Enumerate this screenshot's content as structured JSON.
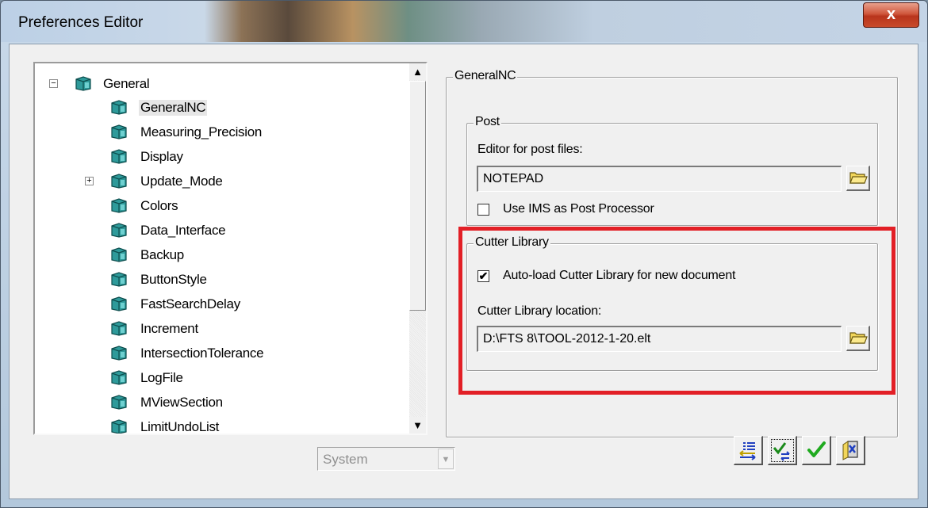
{
  "window": {
    "title": "Preferences Editor",
    "close_label": "x"
  },
  "tree": {
    "root": {
      "label": "General",
      "expander": "−"
    },
    "items": [
      {
        "label": "GeneralNC",
        "selected": true
      },
      {
        "label": "Measuring_Precision"
      },
      {
        "label": "Display"
      },
      {
        "label": "Update_Mode",
        "expander": "+"
      },
      {
        "label": "Colors"
      },
      {
        "label": "Data_Interface"
      },
      {
        "label": "Backup"
      },
      {
        "label": "ButtonStyle"
      },
      {
        "label": "FastSearchDelay"
      },
      {
        "label": "Increment"
      },
      {
        "label": "IntersectionTolerance"
      },
      {
        "label": "LogFile"
      },
      {
        "label": "MViewSection"
      },
      {
        "label": "LimitUndoList"
      }
    ],
    "scroll_up": "▲",
    "scroll_down": "▼"
  },
  "panel": {
    "title": "GeneralNC",
    "post": {
      "title": "Post",
      "editor_label": "Editor for post files:",
      "editor_value": "NOTEPAD",
      "use_ims_label": "Use IMS as Post Processor",
      "use_ims_checked": false
    },
    "cutter": {
      "title": "Cutter Library",
      "autoload_label": "Auto-load Cutter Library for new document",
      "autoload_checked": true,
      "location_label": "Cutter Library location:",
      "location_value": "D:\\FTS 8\\TOOL-2012-1-20.elt"
    }
  },
  "scope_select": {
    "value": "System",
    "arrow": "▼"
  },
  "colors": {
    "highlight": "#e21f26",
    "check_green": "#1faa1f",
    "folder_yellow": "#f2d65a"
  },
  "buttons": [
    "list-arrows-icon",
    "check-swap-icon",
    "checkmark-icon",
    "exit-icon"
  ]
}
